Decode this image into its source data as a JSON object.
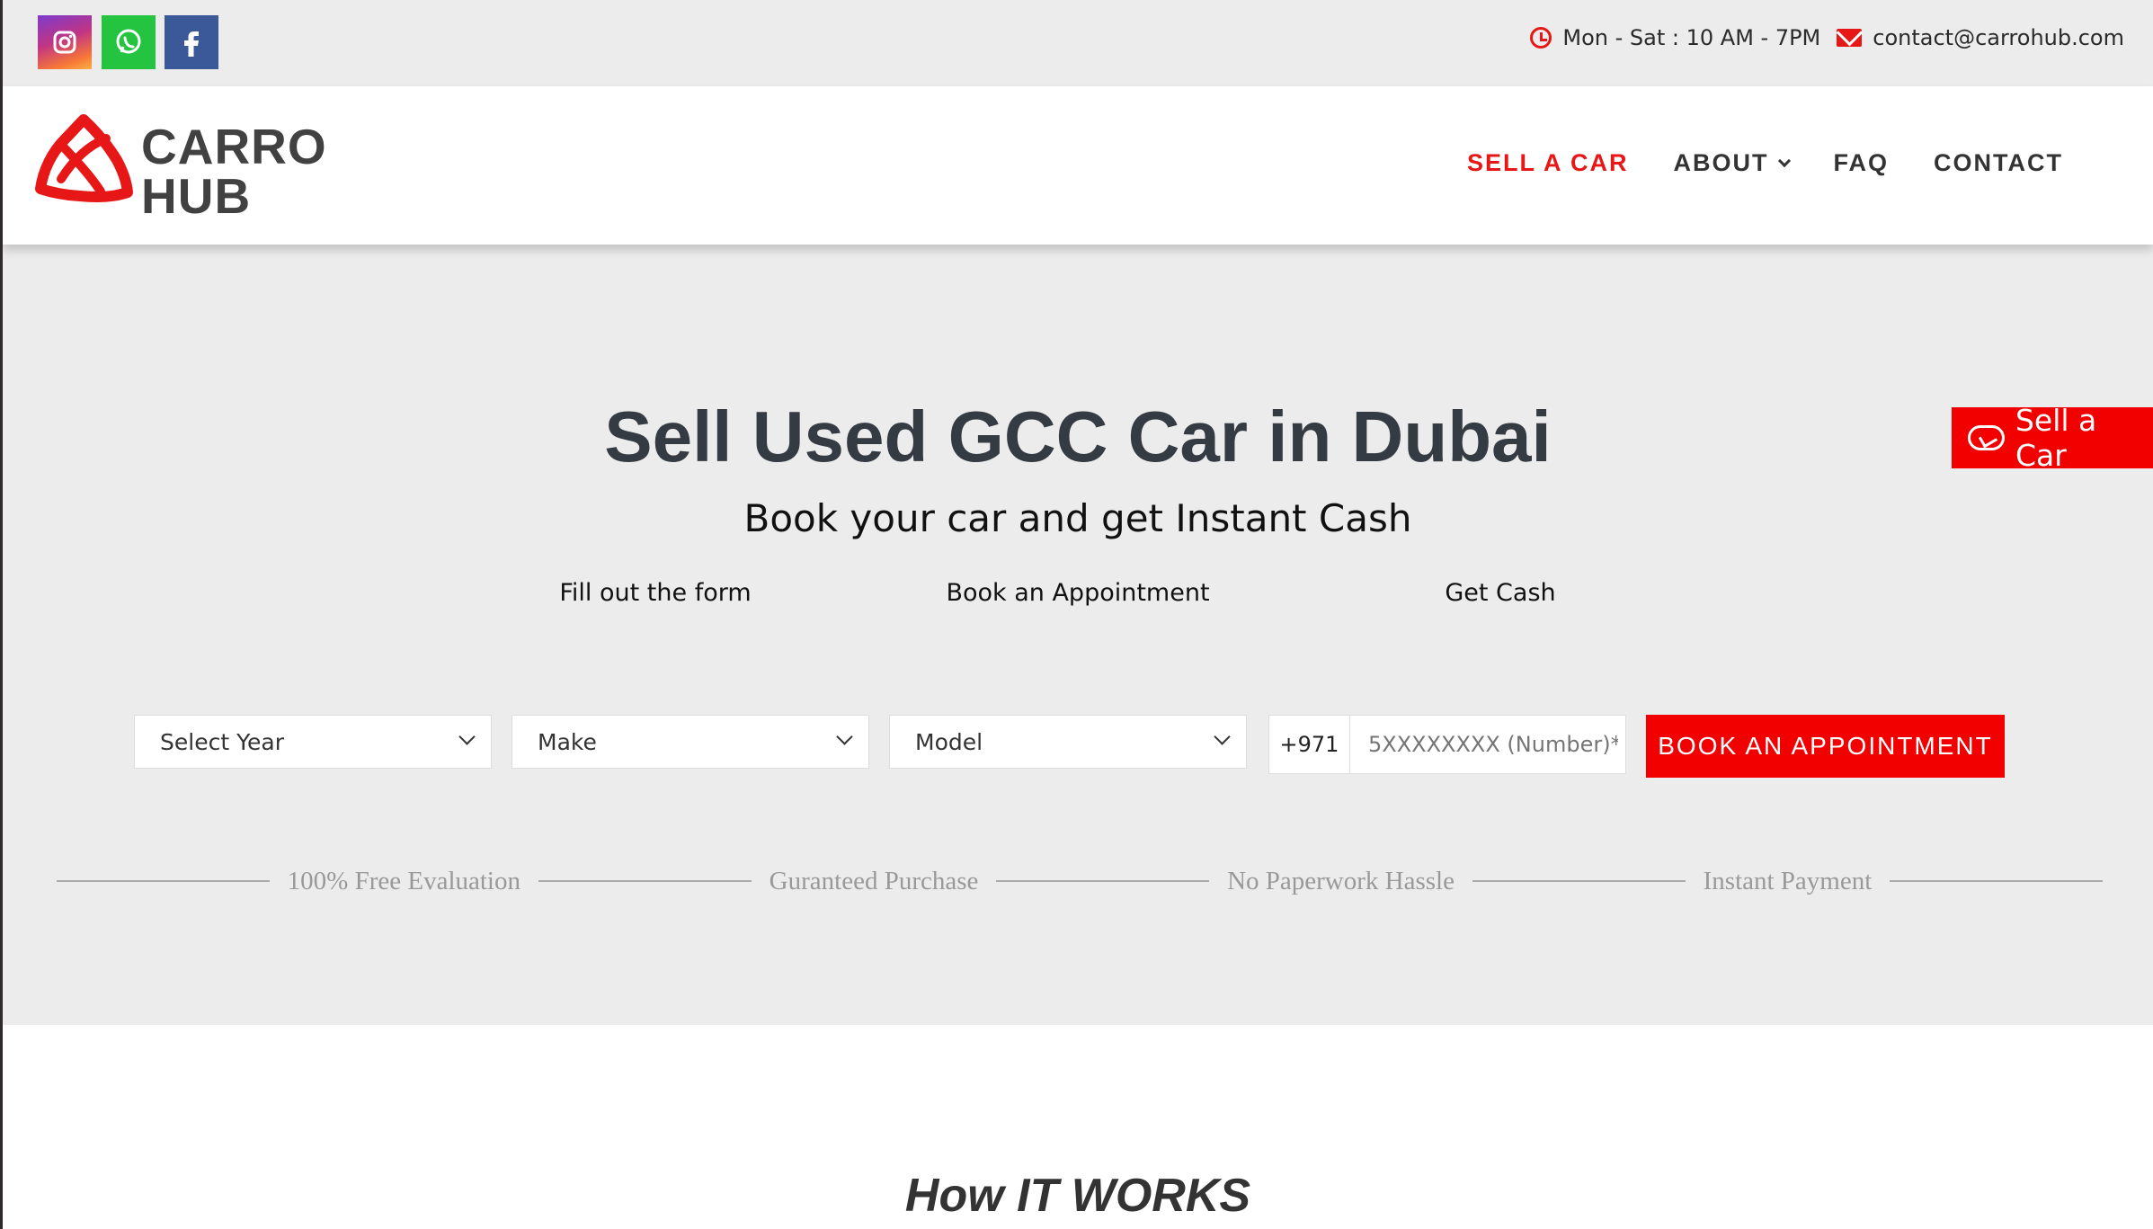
{
  "topbar": {
    "social": [
      "instagram",
      "whatsapp",
      "facebook"
    ],
    "hours": "Mon - Sat : 10 AM - 7PM",
    "email": "contact@carrohub.com"
  },
  "header": {
    "logo_line1": "CARRO",
    "logo_line2": "HUB",
    "nav": [
      "SELL A CAR",
      "ABOUT",
      "FAQ",
      "CONTACT"
    ]
  },
  "hero": {
    "title": "Sell Used GCC Car in Dubai",
    "subtitle": "Book your car and get Instant Cash",
    "steps": [
      "Fill out the form",
      "Book an Appointment",
      "Get Cash"
    ]
  },
  "form": {
    "year_placeholder": "Select Year",
    "make_placeholder": "Make",
    "model_placeholder": "Model",
    "phone_prefix": "+971",
    "phone_placeholder": "5XXXXXXXX (Number)*",
    "button": "BOOK AN APPOINTMENT"
  },
  "features": [
    "100% Free Evaluation",
    "Guranteed Purchase",
    "No Paperwork Hassle",
    "Instant Payment"
  ],
  "floating_button": "Sell a Car",
  "how_title": "How IT WORKS",
  "colors": {
    "accent": "#e81717",
    "button": "#f20000",
    "background": "#ececec"
  }
}
